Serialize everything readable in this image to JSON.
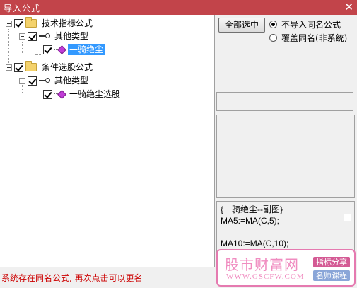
{
  "window": {
    "title": "导入公式",
    "close_glyph": "✕"
  },
  "tree": {
    "groups": [
      {
        "label": "技术指标公式",
        "type_label": "其他类型",
        "formula": "一骑绝尘"
      },
      {
        "label": "条件选股公式",
        "type_label": "其他类型",
        "formula": "一骑绝尘选股"
      }
    ]
  },
  "controls": {
    "select_all_label": "全部选中",
    "radio_skip_label": "不导入同名公式",
    "radio_overwrite_label": "覆盖同名(非系统)",
    "selected_radio": "skip"
  },
  "formula_preview": {
    "lines": [
      "{一骑绝尘--副图}",
      "MA5:=MA(C,5);",
      "",
      "MA10:=MA(C,10);"
    ]
  },
  "status": {
    "message": "系统存在同名公式, 再次点击可以更名"
  },
  "watermark": {
    "brand": "股市财富网",
    "url": "WWW.GSCFW.COM",
    "tag1": "指标分享",
    "tag2": "名师课程"
  },
  "colors": {
    "titlebar": "#c2444a",
    "selection": "#3399ff",
    "status_text": "#cc0000",
    "watermark": "#f08cc0"
  },
  "icons": [
    "close-icon",
    "expander-icon",
    "checkbox-icon",
    "folder-icon",
    "key-icon",
    "formula-gem-icon",
    "radio-icon"
  ]
}
